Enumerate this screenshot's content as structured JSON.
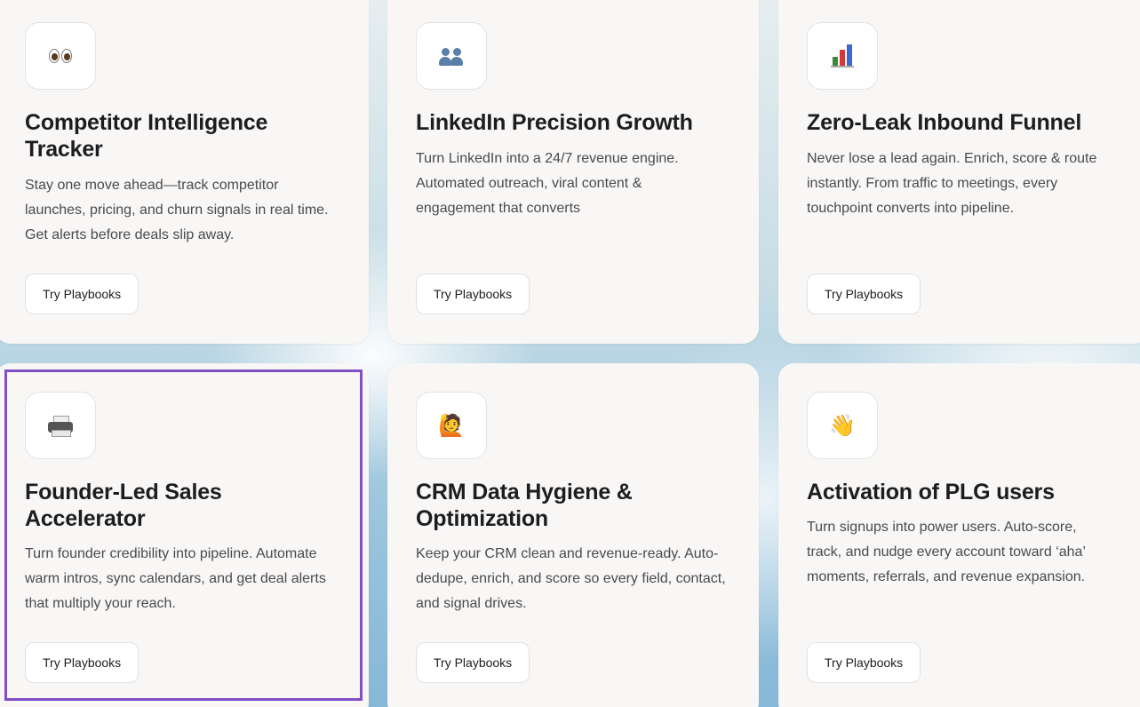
{
  "cards": [
    {
      "icon": "eyes-icon",
      "title": "Competitor Intelligence Tracker",
      "description": "Stay one move ahead—track competitor launches, pricing, and churn signals in real time. Get alerts before deals slip away.",
      "cta": "Try Playbooks"
    },
    {
      "icon": "busts-in-silhouette-icon",
      "title": "LinkedIn Precision Growth",
      "description": "Turn LinkedIn into a 24/7 revenue engine. Automated outreach, viral content & engagement that converts",
      "cta": "Try Playbooks"
    },
    {
      "icon": "bar-chart-icon",
      "title": "Zero-Leak Inbound Funnel",
      "description": "Never lose a lead again. Enrich, score & route instantly. From traffic to meetings, every touchpoint converts into pipeline.",
      "cta": "Try Playbooks"
    },
    {
      "icon": "printer-icon",
      "title": "Founder-Led Sales Accelerator",
      "description": "Turn founder credibility into pipeline. Automate warm intros, sync calendars, and get deal alerts that multiply your reach.",
      "cta": "Try Playbooks"
    },
    {
      "icon": "person-raising-hand-icon",
      "title": "CRM Data Hygiene & Optimization",
      "description": "Keep your CRM clean and revenue-ready. Auto-dedupe, enrich, and score so every field, contact, and signal drives.",
      "cta": "Try Playbooks"
    },
    {
      "icon": "waving-hand-icon",
      "title": "Activation of PLG users",
      "description": "Turn signups into power users. Auto-score, track, and nudge every account toward ‘aha’ moments, referrals, and revenue expansion.",
      "cta": "Try Playbooks"
    }
  ],
  "colors": {
    "card_background": "#f8f7f5",
    "title_text": "#1d1d21",
    "body_text": "#4a4a4f",
    "highlight_border": "#7e4fc7"
  }
}
